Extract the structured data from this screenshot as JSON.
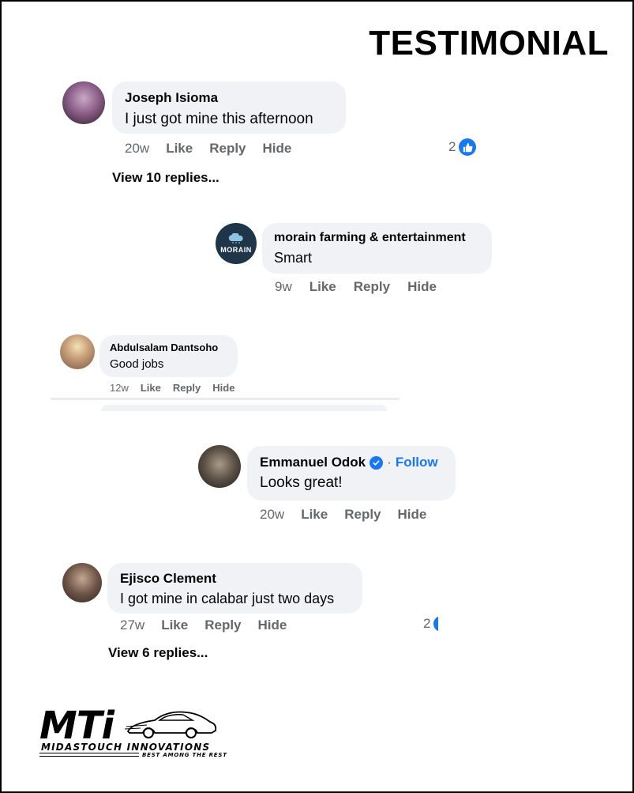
{
  "header": {
    "title": "TESTIMONIAL"
  },
  "comments": [
    {
      "name": "Joseph Isioma",
      "text": "I just got mine this afternoon",
      "time": "20w",
      "actions": [
        "Like",
        "Reply",
        "Hide"
      ],
      "reaction_count": "2",
      "view_replies": "View 10 replies..."
    },
    {
      "name": "morain farming & entertainment",
      "avatar_logo": "MORAIN",
      "text": "Smart",
      "time": "9w",
      "actions": [
        "Like",
        "Reply",
        "Hide"
      ]
    },
    {
      "name": "Abdulsalam Dantsoho",
      "text": "Good jobs",
      "time": "12w",
      "actions": [
        "Like",
        "Reply",
        "Hide"
      ]
    },
    {
      "name": "Emmanuel Odok",
      "follow_separator": "·",
      "follow_label": "Follow",
      "text": "Looks great!",
      "time": "20w",
      "actions": [
        "Like",
        "Reply",
        "Hide"
      ]
    },
    {
      "name": "Ejisco Clement",
      "text": "I got mine in calabar just two days",
      "time": "27w",
      "actions": [
        "Like",
        "Reply",
        "Hide"
      ],
      "reaction_count": "2",
      "view_replies": "View 6 replies..."
    }
  ],
  "brand": {
    "mark": "MTi",
    "name": "MIDASTOUCH INNOVATIONS",
    "tagline": "BEST AMONG THE REST"
  },
  "colors": {
    "bubble": "#f0f2f5",
    "accent": "#1877f2",
    "meta": "#65676b",
    "text": "#050505"
  },
  "icons": {
    "like_reaction": "thumbs-up-icon",
    "verified": "verified-badge-icon",
    "car_logo": "sports-car-icon"
  }
}
